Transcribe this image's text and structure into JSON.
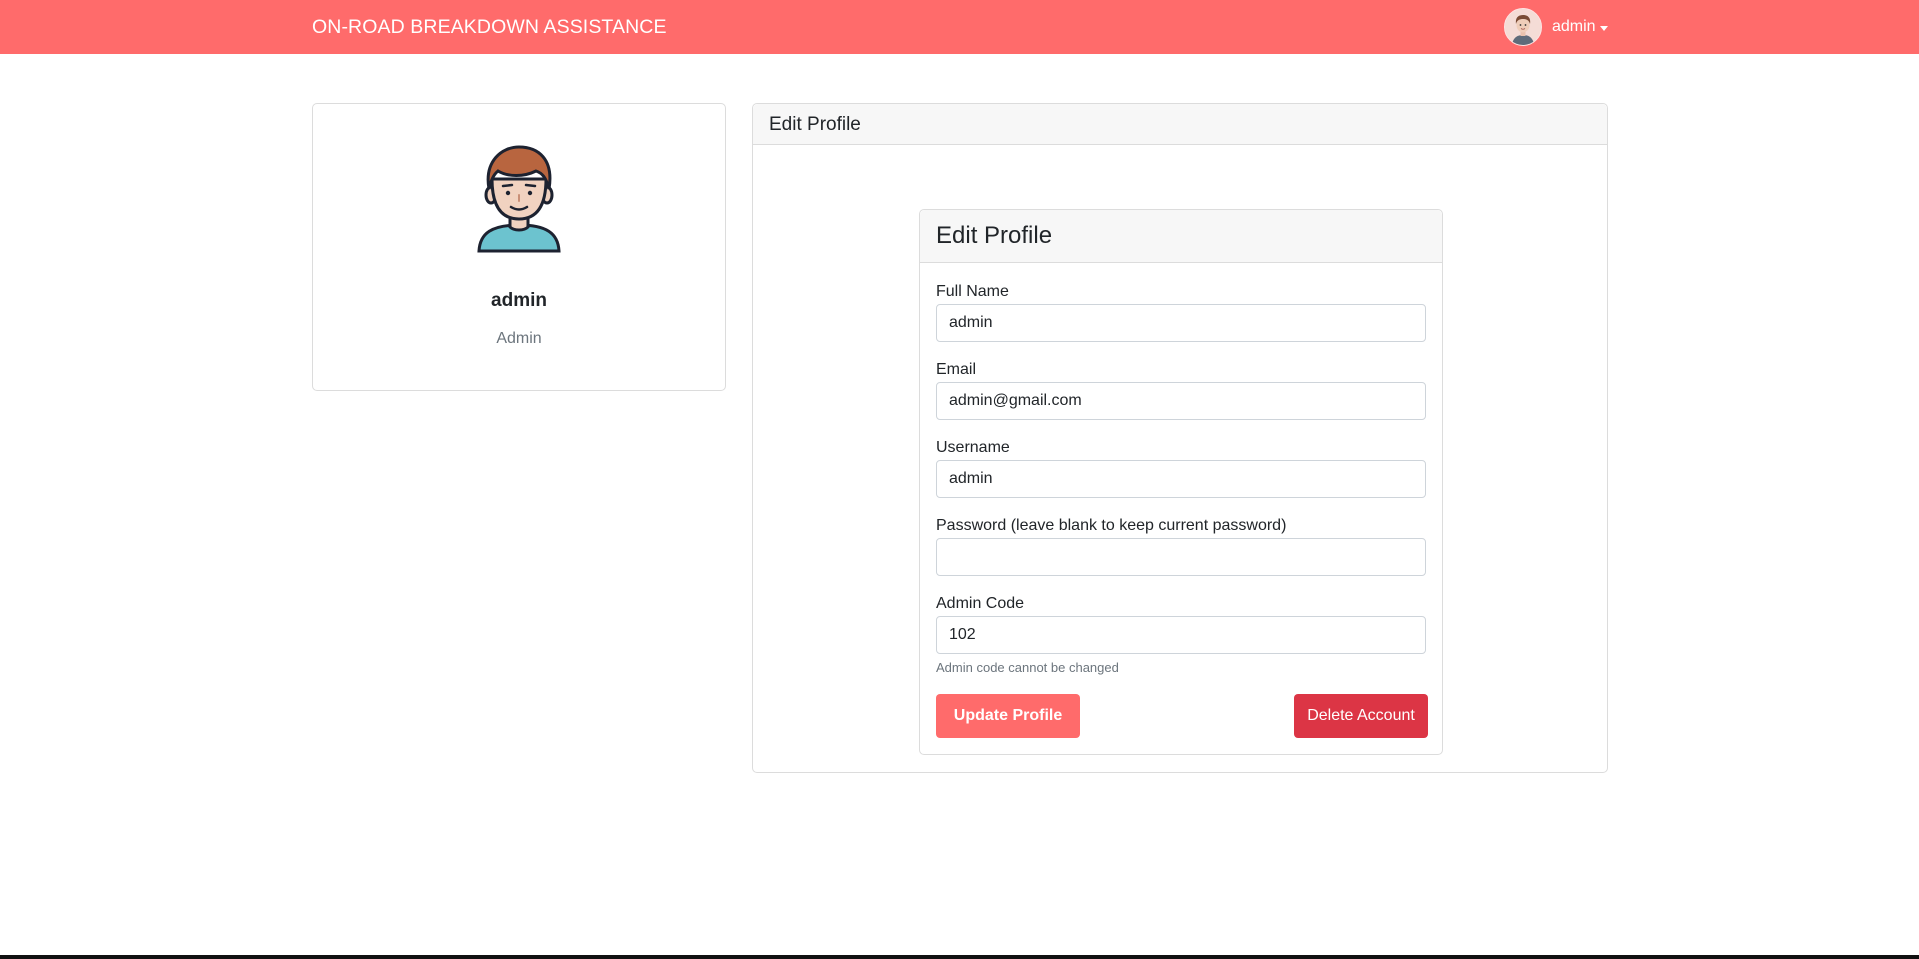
{
  "navbar": {
    "brand": "ON-ROAD BREAKDOWN ASSISTANCE",
    "user_name": "admin",
    "avatar_icon": "user-avatar-icon",
    "dropdown_icon": "caret-down-icon",
    "background_color": "#ff6b6b"
  },
  "profile_card": {
    "avatar_icon": "male-avatar-icon",
    "name": "admin",
    "role": "Admin"
  },
  "outer_card": {
    "title": "Edit Profile"
  },
  "form": {
    "title": "Edit Profile",
    "full_name": {
      "label": "Full Name",
      "value": "admin"
    },
    "email": {
      "label": "Email",
      "value": "admin@gmail.com"
    },
    "username": {
      "label": "Username",
      "value": "admin"
    },
    "password": {
      "label": "Password (leave blank to keep current password)",
      "value": ""
    },
    "admin_code": {
      "label": "Admin Code",
      "value": "102",
      "help": "Admin code cannot be changed"
    },
    "update_button": "Update Profile",
    "delete_button": "Delete Account"
  },
  "colors": {
    "primary": "#ff6b6b",
    "danger": "#dc3545"
  }
}
